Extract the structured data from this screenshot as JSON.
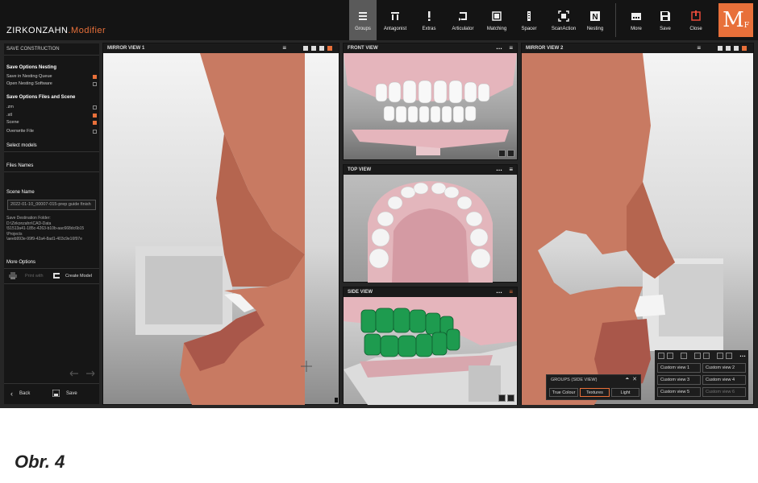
{
  "brand": {
    "name": "ZIRKONZAHN",
    "module": ".Modifier"
  },
  "toolbar": {
    "groups": "Groups",
    "antagonist": "Antagonist",
    "extras": "Extras",
    "articulator": "Articulator",
    "matching": "Matching",
    "spacer": "Spacer",
    "scanaction": "ScanAction",
    "nesting": "Nesting",
    "more": "More",
    "save": "Save",
    "close": "Close"
  },
  "logo": {
    "letter": "M",
    "sub": "F",
    "color": "#e8703a"
  },
  "left_panel": {
    "title": "SAVE CONSTRUCTION",
    "nesting_header": "Save Options Nesting",
    "nesting_items": [
      {
        "label": "Save in Nesting Queue",
        "checked": true
      },
      {
        "label": "Open Nesting Software",
        "checked": false
      }
    ],
    "files_header": "Save Options Files and Scene",
    "file_items": [
      {
        "label": ".zm",
        "checked": false
      },
      {
        "label": ".stl",
        "checked": true
      },
      {
        "label": "Scene",
        "checked": true
      },
      {
        "label": "Overwrite File",
        "checked": false
      }
    ],
    "select_models": "Select models",
    "file_names": "Files Names",
    "scene_name_label": "Scene Name",
    "scene_name_value": "2022-01-10_00007-015-prep guide finish",
    "dest_label": "Save Destination Folder:",
    "dest_path": [
      "D:\\Zirkonzahn\\CAD-Data",
      "\\51513a41-185c-4263-b10b-aac668dc6b15",
      "\\Projects",
      "\\aeeb993e-99f9-42a4-8ad1-403c9e16f97e"
    ],
    "more_options": "More Options",
    "print_with": "Print with",
    "create_model": "Create Model",
    "back": "Back",
    "save": "Save"
  },
  "views": {
    "mirror1": "MIRROR VIEW 1",
    "front": "FRONT VIEW",
    "top": "TOP VIEW",
    "side": "SIDE VIEW",
    "mirror2": "MIRROR VIEW 2"
  },
  "groups_popup": {
    "title": "GROUPS (SIDE VIEW)",
    "buttons": [
      "True Colour",
      "Textures",
      "Light"
    ]
  },
  "custom_views": [
    "Custom view 1",
    "Custom view 2",
    "Custom view 3",
    "Custom view 4",
    "Custom view 5",
    "Custom view 6"
  ],
  "caption": "Obr. 4"
}
